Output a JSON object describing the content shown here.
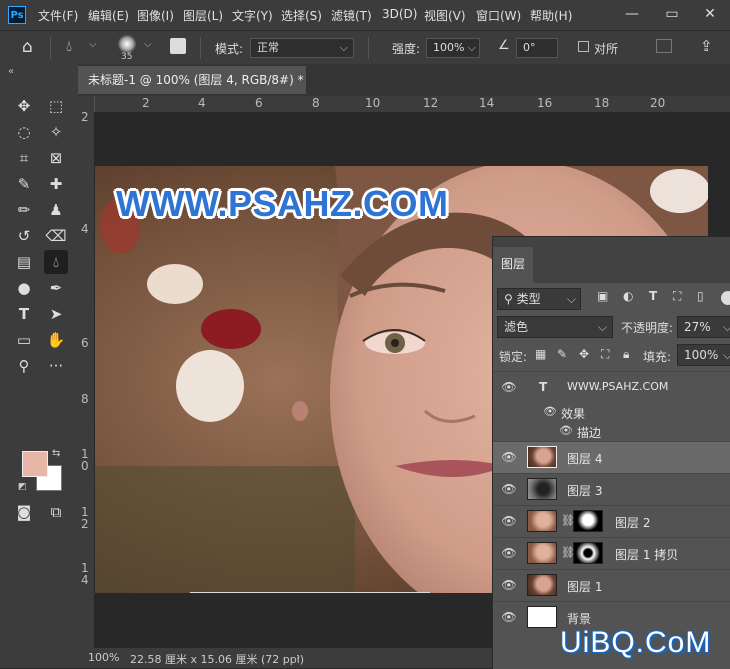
{
  "app": {
    "logo_text": "Ps"
  },
  "menu": [
    "文件(F)",
    "编辑(E)",
    "图像(I)",
    "图层(L)",
    "文字(Y)",
    "选择(S)",
    "滤镜(T)",
    "3D(D)",
    "视图(V)",
    "窗口(W)",
    "帮助(H)"
  ],
  "window_controls": {
    "minimize": "—",
    "restore": "▭",
    "close": "✕"
  },
  "options": {
    "brush_size": "35",
    "mode_label": "模式:",
    "mode_value": "正常",
    "opacity_label": "强度:",
    "opacity_value": "100%",
    "angle_value": "0°",
    "align_label": "对所"
  },
  "document": {
    "tab_title": "未标题-1 @ 100% (图层 4, RGB/8#) *",
    "ruler_top": [
      "2",
      "2",
      "4",
      "6",
      "8",
      "10",
      "12",
      "14",
      "16",
      "18",
      "20"
    ],
    "ruler_left": [
      "2",
      "4",
      "6",
      "8",
      "1\n0",
      "1\n2",
      "1\n4"
    ],
    "watermark": "WWW.PSAHZ.COM",
    "zoom": "100%",
    "doc_info": "22.58 厘米 x 15.06 厘米 (72 ppi)"
  },
  "layers_panel": {
    "tab": "图层",
    "filter_label": "类型",
    "blend_mode": "滤色",
    "opacity_label": "不透明度:",
    "opacity_value": "27%",
    "lock_label": "锁定:",
    "fill_label": "填充:",
    "fill_value": "100%",
    "layers": [
      {
        "name": "WWW.PSAHZ.COM",
        "type": "text"
      },
      {
        "name": "效果",
        "type": "effects"
      },
      {
        "name": "描边",
        "type": "effect"
      },
      {
        "name": "图层 4",
        "type": "image",
        "active": true
      },
      {
        "name": "图层 3",
        "type": "image"
      },
      {
        "name": "图层 2",
        "type": "masked"
      },
      {
        "name": "图层 1 拷贝",
        "type": "masked"
      },
      {
        "name": "图层 1",
        "type": "image"
      },
      {
        "name": "背景",
        "type": "background"
      }
    ]
  },
  "site_watermark": "UiBQ.CoM",
  "colors": {
    "foreground": "#e7b6a7",
    "background": "#ffffff",
    "panel": "#535353",
    "chrome": "#3c3c3c"
  }
}
